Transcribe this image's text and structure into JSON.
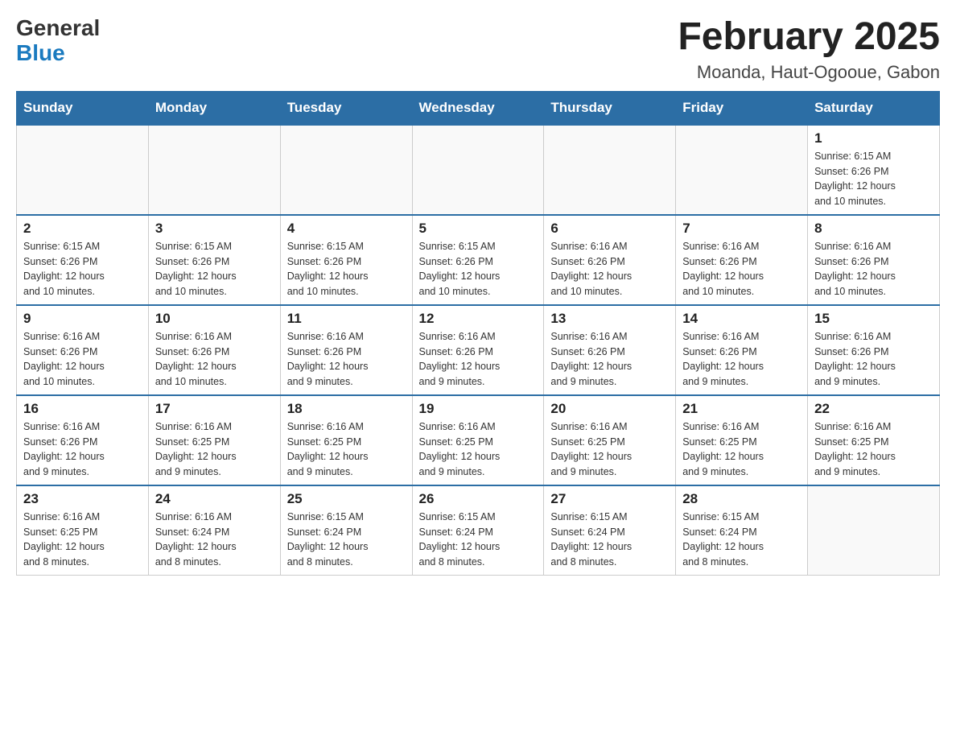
{
  "header": {
    "logo_general": "General",
    "logo_blue": "Blue",
    "month_title": "February 2025",
    "location": "Moanda, Haut-Ogooue, Gabon"
  },
  "weekdays": [
    "Sunday",
    "Monday",
    "Tuesday",
    "Wednesday",
    "Thursday",
    "Friday",
    "Saturday"
  ],
  "weeks": [
    [
      {
        "day": "",
        "info": ""
      },
      {
        "day": "",
        "info": ""
      },
      {
        "day": "",
        "info": ""
      },
      {
        "day": "",
        "info": ""
      },
      {
        "day": "",
        "info": ""
      },
      {
        "day": "",
        "info": ""
      },
      {
        "day": "1",
        "info": "Sunrise: 6:15 AM\nSunset: 6:26 PM\nDaylight: 12 hours\nand 10 minutes."
      }
    ],
    [
      {
        "day": "2",
        "info": "Sunrise: 6:15 AM\nSunset: 6:26 PM\nDaylight: 12 hours\nand 10 minutes."
      },
      {
        "day": "3",
        "info": "Sunrise: 6:15 AM\nSunset: 6:26 PM\nDaylight: 12 hours\nand 10 minutes."
      },
      {
        "day": "4",
        "info": "Sunrise: 6:15 AM\nSunset: 6:26 PM\nDaylight: 12 hours\nand 10 minutes."
      },
      {
        "day": "5",
        "info": "Sunrise: 6:15 AM\nSunset: 6:26 PM\nDaylight: 12 hours\nand 10 minutes."
      },
      {
        "day": "6",
        "info": "Sunrise: 6:16 AM\nSunset: 6:26 PM\nDaylight: 12 hours\nand 10 minutes."
      },
      {
        "day": "7",
        "info": "Sunrise: 6:16 AM\nSunset: 6:26 PM\nDaylight: 12 hours\nand 10 minutes."
      },
      {
        "day": "8",
        "info": "Sunrise: 6:16 AM\nSunset: 6:26 PM\nDaylight: 12 hours\nand 10 minutes."
      }
    ],
    [
      {
        "day": "9",
        "info": "Sunrise: 6:16 AM\nSunset: 6:26 PM\nDaylight: 12 hours\nand 10 minutes."
      },
      {
        "day": "10",
        "info": "Sunrise: 6:16 AM\nSunset: 6:26 PM\nDaylight: 12 hours\nand 10 minutes."
      },
      {
        "day": "11",
        "info": "Sunrise: 6:16 AM\nSunset: 6:26 PM\nDaylight: 12 hours\nand 9 minutes."
      },
      {
        "day": "12",
        "info": "Sunrise: 6:16 AM\nSunset: 6:26 PM\nDaylight: 12 hours\nand 9 minutes."
      },
      {
        "day": "13",
        "info": "Sunrise: 6:16 AM\nSunset: 6:26 PM\nDaylight: 12 hours\nand 9 minutes."
      },
      {
        "day": "14",
        "info": "Sunrise: 6:16 AM\nSunset: 6:26 PM\nDaylight: 12 hours\nand 9 minutes."
      },
      {
        "day": "15",
        "info": "Sunrise: 6:16 AM\nSunset: 6:26 PM\nDaylight: 12 hours\nand 9 minutes."
      }
    ],
    [
      {
        "day": "16",
        "info": "Sunrise: 6:16 AM\nSunset: 6:26 PM\nDaylight: 12 hours\nand 9 minutes."
      },
      {
        "day": "17",
        "info": "Sunrise: 6:16 AM\nSunset: 6:25 PM\nDaylight: 12 hours\nand 9 minutes."
      },
      {
        "day": "18",
        "info": "Sunrise: 6:16 AM\nSunset: 6:25 PM\nDaylight: 12 hours\nand 9 minutes."
      },
      {
        "day": "19",
        "info": "Sunrise: 6:16 AM\nSunset: 6:25 PM\nDaylight: 12 hours\nand 9 minutes."
      },
      {
        "day": "20",
        "info": "Sunrise: 6:16 AM\nSunset: 6:25 PM\nDaylight: 12 hours\nand 9 minutes."
      },
      {
        "day": "21",
        "info": "Sunrise: 6:16 AM\nSunset: 6:25 PM\nDaylight: 12 hours\nand 9 minutes."
      },
      {
        "day": "22",
        "info": "Sunrise: 6:16 AM\nSunset: 6:25 PM\nDaylight: 12 hours\nand 9 minutes."
      }
    ],
    [
      {
        "day": "23",
        "info": "Sunrise: 6:16 AM\nSunset: 6:25 PM\nDaylight: 12 hours\nand 8 minutes."
      },
      {
        "day": "24",
        "info": "Sunrise: 6:16 AM\nSunset: 6:24 PM\nDaylight: 12 hours\nand 8 minutes."
      },
      {
        "day": "25",
        "info": "Sunrise: 6:15 AM\nSunset: 6:24 PM\nDaylight: 12 hours\nand 8 minutes."
      },
      {
        "day": "26",
        "info": "Sunrise: 6:15 AM\nSunset: 6:24 PM\nDaylight: 12 hours\nand 8 minutes."
      },
      {
        "day": "27",
        "info": "Sunrise: 6:15 AM\nSunset: 6:24 PM\nDaylight: 12 hours\nand 8 minutes."
      },
      {
        "day": "28",
        "info": "Sunrise: 6:15 AM\nSunset: 6:24 PM\nDaylight: 12 hours\nand 8 minutes."
      },
      {
        "day": "",
        "info": ""
      }
    ]
  ]
}
